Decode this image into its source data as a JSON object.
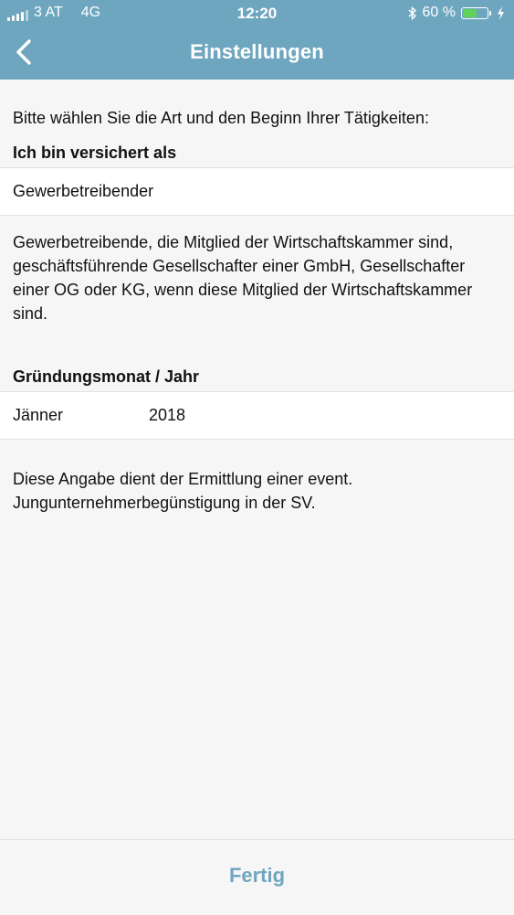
{
  "status_bar": {
    "carrier": "3 AT",
    "network": "4G",
    "time": "12:20",
    "battery_text": "60 %",
    "battery_level": 0.6,
    "icons": [
      "signal-icon",
      "bluetooth-icon",
      "battery-icon",
      "charging-icon"
    ]
  },
  "nav": {
    "back_icon": "chevron-left-icon",
    "title": "Einstellungen"
  },
  "content": {
    "intro": "Bitte wählen Sie die Art und den Beginn Ihrer Tätigkeiten:",
    "insured_label": "Ich bin versichert als",
    "insured_value": "Gewerbetreibender",
    "insured_description": "Gewerbetreibende, die Mitglied der Wirtschaftskammer sind, geschäftsführende Gesellschafter einer GmbH, Gesellschafter einer OG oder KG, wenn diese Mitglied der Wirtschaftskammer sind.",
    "founding_label": "Gründungsmonat / Jahr",
    "founding_month": "Jänner",
    "founding_year": "2018",
    "founding_note": "Diese Angabe dient der Ermittlung einer event. Jungunternehmerbegünstigung in der SV."
  },
  "footer": {
    "done_label": "Fertig"
  },
  "colors": {
    "header": "#6fa6bf",
    "accent": "#6fa6bf",
    "background": "#f6f6f6",
    "battery": "#5ed25a"
  }
}
